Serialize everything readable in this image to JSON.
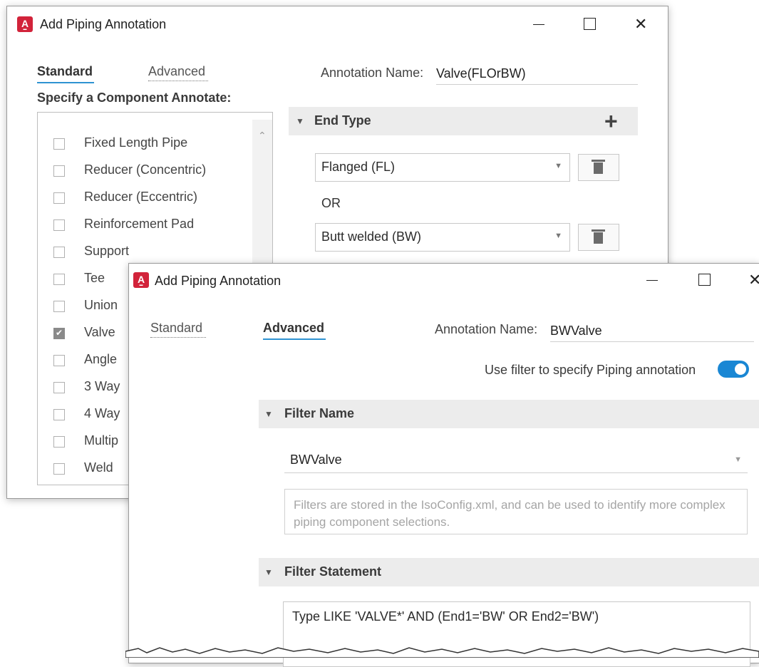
{
  "dialog_back": {
    "title": "Add Piping Annotation",
    "app_icon_letter": "A",
    "tabs": [
      {
        "label": "Standard",
        "active": true
      },
      {
        "label": "Advanced",
        "active": false
      }
    ],
    "annotation_name_label": "Annotation Name:",
    "annotation_name_value": "Valve(FLOrBW)",
    "component_heading": "Specify a Component Annotate:",
    "components": [
      {
        "label": "Fixed Length Pipe",
        "checked": false
      },
      {
        "label": "Reducer (Concentric)",
        "checked": false
      },
      {
        "label": "Reducer (Eccentric)",
        "checked": false
      },
      {
        "label": "Reinforcement Pad",
        "checked": false
      },
      {
        "label": "Support",
        "checked": false
      },
      {
        "label": "Tee",
        "checked": false
      },
      {
        "label": "Union",
        "checked": false
      },
      {
        "label": "Valve",
        "checked": true
      },
      {
        "label": "Angle",
        "checked": false
      },
      {
        "label": "3 Way",
        "checked": false
      },
      {
        "label": "4 Way",
        "checked": false
      },
      {
        "label": "Multip",
        "checked": false
      },
      {
        "label": "Weld",
        "checked": false
      }
    ],
    "end_type_section": "End Type",
    "end_types": [
      "Flanged (FL)",
      "Butt welded (BW)"
    ],
    "or_label": "OR"
  },
  "dialog_front": {
    "title": "Add Piping Annotation",
    "app_icon_letter": "A",
    "tabs": [
      {
        "label": "Standard",
        "active": false
      },
      {
        "label": "Advanced",
        "active": true
      }
    ],
    "annotation_name_label": "Annotation Name:",
    "annotation_name_value": "BWValve",
    "filter_toggle_label": "Use filter to specify Piping annotation",
    "filter_toggle_on": true,
    "filter_name_section": "Filter Name",
    "filter_name_value": "BWValve",
    "filter_info": "Filters are stored in the IsoConfig.xml, and can be used to identify more complex piping component selections.",
    "filter_statement_section": "Filter Statement",
    "filter_statement_value": "Type LIKE 'VALVE*' AND (End1='BW' OR End2='BW')"
  },
  "colors": {
    "accent": "#1a87d4",
    "tab_underline": "#2f93d2",
    "app_icon": "#d2233a",
    "section_header_bg": "#ececec"
  }
}
